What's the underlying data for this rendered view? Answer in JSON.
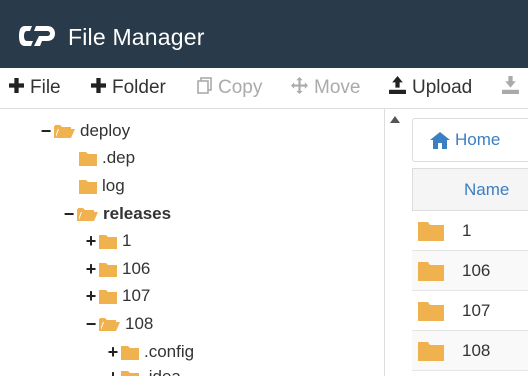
{
  "header": {
    "title": "File Manager",
    "logo_icon": "cpanel-logo-icon"
  },
  "toolbar": {
    "file": "File",
    "folder": "Folder",
    "copy": "Copy",
    "move": "Move",
    "upload": "Upload"
  },
  "tree": {
    "deploy": "deploy",
    "dep": ".dep",
    "log": "log",
    "releases": "releases",
    "r1": "1",
    "r106": "106",
    "r107": "107",
    "r108": "108",
    "config": ".config",
    "idea": ".idea"
  },
  "main": {
    "home": "Home",
    "col_name": "Name",
    "rows": [
      "1",
      "106",
      "107",
      "108"
    ]
  },
  "colors": {
    "header_bg": "#293a4a",
    "folder": "#f0b24f",
    "link": "#3a7fc1"
  }
}
